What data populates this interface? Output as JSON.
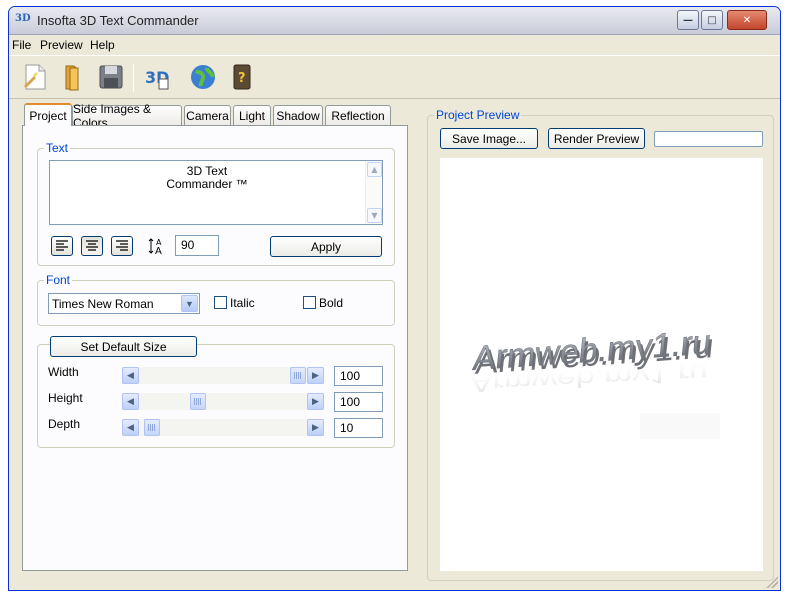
{
  "window": {
    "title": "Insofta 3D Text Commander",
    "minimize_glyph": "—",
    "maximize_glyph": "□",
    "close_glyph": "✕"
  },
  "menu": {
    "items": [
      "File",
      "Preview",
      "Help"
    ]
  },
  "toolbar": {
    "tools": [
      "new-project-icon",
      "open-folder-icon",
      "save-disk-icon",
      "3d-text-icon",
      "globe-icon",
      "help-book-icon"
    ]
  },
  "tabs": [
    "Project",
    "Side Images & Colors",
    "Camera",
    "Light",
    "Shadow",
    "Reflection"
  ],
  "text_group": {
    "label": "Text",
    "lines": [
      "3D Text",
      "Commander ™"
    ],
    "size_value": "90",
    "apply_label": "Apply"
  },
  "font_group": {
    "label": "Font",
    "selected_font": "Times New Roman",
    "italic_label": "Italic",
    "bold_label": "Bold",
    "italic_checked": false,
    "bold_checked": false
  },
  "size_group": {
    "default_button": "Set Default Size",
    "sliders": [
      {
        "label": "Width",
        "value": "100",
        "level": 1.0
      },
      {
        "label": "Height",
        "value": "100",
        "level": 0.4
      },
      {
        "label": "Depth",
        "value": "10",
        "level": 0.0
      }
    ]
  },
  "preview_panel": {
    "label": "Project Preview",
    "save_button": "Save Image...",
    "render_button": "Render Preview",
    "rendered_text": "Armweb.my1.ru"
  }
}
